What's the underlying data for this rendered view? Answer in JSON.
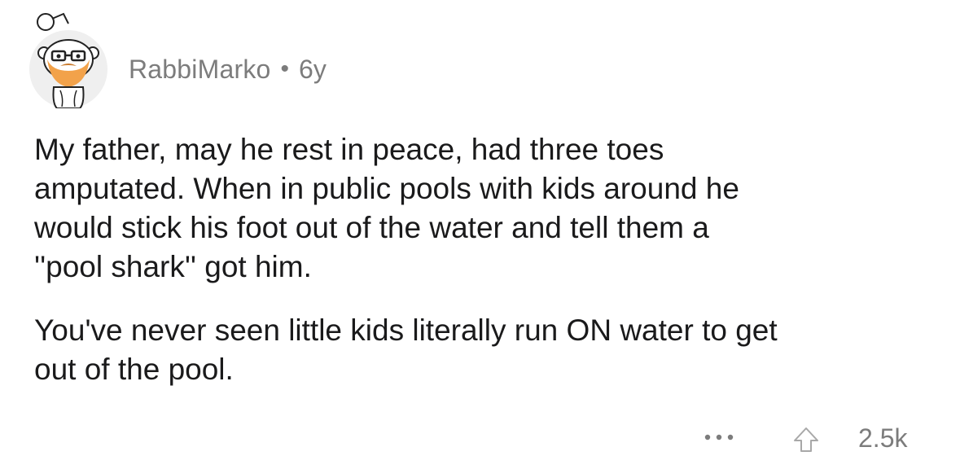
{
  "comment": {
    "author": "RabbiMarko",
    "separator": "•",
    "age": "6y",
    "avatar_icon": "snoo-avatar-icon",
    "paragraphs": [
      "My father, may he rest in peace, had three toes\namputated.  When in public pools with kids around he\nwould stick his foot out of the water and tell them a\n''pool shark'' got him.",
      "You've never seen little kids literally run ON water to get\nout of the pool."
    ],
    "actions": {
      "more_icon": "more-dots-icon",
      "upvote_icon": "upvote-arrow-icon",
      "score": "2.5k"
    }
  },
  "colors": {
    "text_primary": "#1a1a1b",
    "text_meta": "#7c7c7c",
    "background": "#ffffff",
    "avatar_bg": "#f0f0f0",
    "beard": "#f2a24a"
  }
}
